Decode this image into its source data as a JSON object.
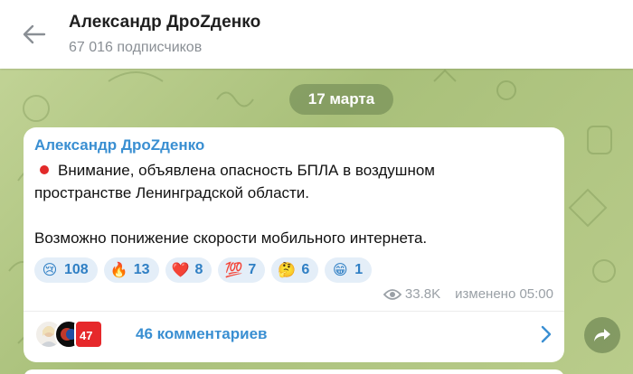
{
  "header": {
    "title": "Александр ДроZденко",
    "subscribers": "67 016 подписчиков"
  },
  "date_label": "17 марта",
  "message": {
    "author": "Александр ДроZденко",
    "line1": "Внимание, объявлена опасность БПЛА в воздушном",
    "line2": "пространстве Ленинградской области.",
    "line3": "Возможно понижение скорости мобильного интернета.",
    "reactions": [
      {
        "emoji": "😢",
        "count": "108"
      },
      {
        "emoji": "🔥",
        "count": "13"
      },
      {
        "emoji": "❤️",
        "count": "8"
      },
      {
        "emoji": "💯",
        "count": "7"
      },
      {
        "emoji": "🤔",
        "count": "6"
      },
      {
        "emoji": "😁",
        "count": "1"
      }
    ],
    "views": "33.8K",
    "edited": "изменено 05:00",
    "comments_label": "46 комментариев"
  },
  "colors": {
    "accent": "#3a8fd2",
    "alert_dot": "#e22a2a"
  }
}
